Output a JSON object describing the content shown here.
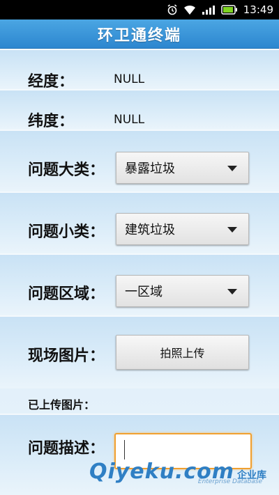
{
  "status_bar": {
    "time": "13:49",
    "icons": [
      "alarm-icon",
      "wifi-icon",
      "signal-icon",
      "battery-icon"
    ]
  },
  "app": {
    "title": "环卫通终端"
  },
  "form": {
    "longitude": {
      "label": "经度：",
      "value": "NULL"
    },
    "latitude": {
      "label": "纬度：",
      "value": "NULL"
    },
    "category": {
      "label": "问题大类：",
      "selected": "暴露垃圾"
    },
    "subcategory": {
      "label": "问题小类：",
      "selected": "建筑垃圾"
    },
    "area": {
      "label": "问题区域：",
      "selected": "一区域"
    },
    "photo": {
      "label": "现场图片：",
      "button_label": "拍照上传"
    },
    "uploaded": {
      "label": "已上传图片："
    },
    "description": {
      "label": "问题描述：",
      "value": ""
    }
  },
  "watermark": {
    "logo": "Qiyeku.com",
    "text": "企业库",
    "subtext": "Enterprise Database"
  },
  "colors": {
    "title_bar": "#2c86cf",
    "input_focus": "#f0a030"
  }
}
